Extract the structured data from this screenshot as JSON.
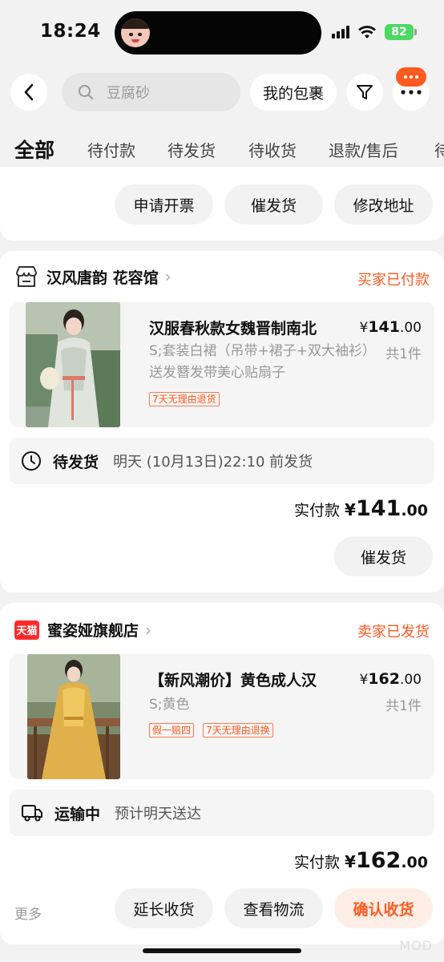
{
  "status_bar": {
    "time": "18:24",
    "battery": "82"
  },
  "nav": {
    "search_placeholder": "豆腐砂",
    "packages_label": "我的包裹"
  },
  "tabs": [
    "全部",
    "待付款",
    "待发货",
    "待收货",
    "退款/售后",
    "待"
  ],
  "top_card": {
    "buttons": [
      "申请开票",
      "催发货",
      "修改地址"
    ]
  },
  "orders": [
    {
      "store": "汉风唐韵 花容馆",
      "status": "买家已付款",
      "product_title": "汉服春秋款女魏晋制南北",
      "price_currency": "¥",
      "price_int": "141",
      "price_dec": ".00",
      "sku": "S;套装白裙（吊带+裙子+双大袖衫）送发簪发带美心贴扇子",
      "qty": "共1件",
      "tags": [
        "7天无理由退货"
      ],
      "ship_status": "待发货",
      "ship_detail": "明天 (10月13日)22:10 前发货",
      "total_label": "实付款",
      "total_currency": "¥",
      "total_int": "141",
      "total_dec": ".00",
      "actions": [
        "催发货"
      ]
    },
    {
      "store": "蜜姿娅旗舰店",
      "store_badge": "天猫",
      "status": "卖家已发货",
      "product_title": "【新风潮价】黄色成人汉",
      "price_currency": "¥",
      "price_int": "162",
      "price_dec": ".00",
      "sku": "S;黄色",
      "qty": "共1件",
      "tags": [
        "假一赔四",
        "7天无理由退换"
      ],
      "ship_status": "运输中",
      "ship_detail": "预计明天送达",
      "total_label": "实付款",
      "total_currency": "¥",
      "total_int": "162",
      "total_dec": ".00",
      "more_label": "更多",
      "actions": [
        "延长收货",
        "查看物流",
        "确认收货"
      ]
    }
  ],
  "colors": {
    "accent": "#ff5a1f",
    "background": "#f2f2f2"
  },
  "watermark": "MOD"
}
